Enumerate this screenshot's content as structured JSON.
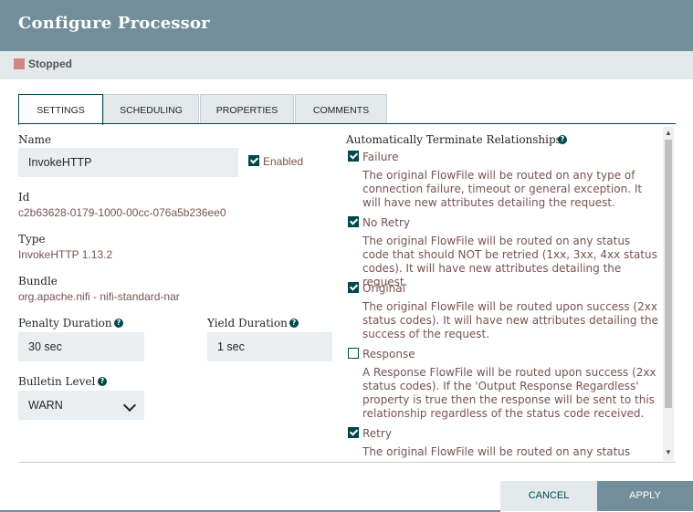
{
  "dialog": {
    "title": "Configure Processor"
  },
  "status": {
    "label": "Stopped",
    "color": "#d18686"
  },
  "tabs": [
    {
      "label": "Settings",
      "active": true
    },
    {
      "label": "Scheduling",
      "active": false
    },
    {
      "label": "Properties",
      "active": false
    },
    {
      "label": "Comments",
      "active": false
    }
  ],
  "settings": {
    "name_label": "Name",
    "name_value": "InvokeHTTP",
    "enabled_label": "Enabled",
    "enabled_checked": true,
    "id_label": "Id",
    "id_value": "c2b63628-0179-1000-00cc-076a5b236ee0",
    "type_label": "Type",
    "type_value": "InvokeHTTP 1.13.2",
    "bundle_label": "Bundle",
    "bundle_value": "org.apache.nifi - nifi-standard-nar",
    "penalty_label": "Penalty Duration",
    "penalty_value": "30 sec",
    "yield_label": "Yield Duration",
    "yield_value": "1 sec",
    "bulletin_label": "Bulletin Level",
    "bulletin_value": "WARN"
  },
  "relationships": {
    "heading": "Automatically Terminate Relationships",
    "items": [
      {
        "name": "Failure",
        "checked": true,
        "desc": "The original FlowFile will be routed on any type of connection failure, timeout or general exception. It will have new attributes detailing the request."
      },
      {
        "name": "No Retry",
        "checked": true,
        "desc": "The original FlowFile will be routed on any status code that should NOT be retried (1xx, 3xx, 4xx status codes). It will have new attributes detailing the request."
      },
      {
        "name": "Original",
        "checked": true,
        "desc": "The original FlowFile will be routed upon success (2xx status codes). It will have new attributes detailing the success of the request."
      },
      {
        "name": "Response",
        "checked": false,
        "desc": "A Response FlowFile will be routed upon success (2xx status codes). If the 'Output Response Regardless' property is true then the response will be sent to this relationship regardless of the status code received."
      },
      {
        "name": "Retry",
        "checked": true,
        "desc": "The original FlowFile will be routed on any status code"
      }
    ]
  },
  "buttons": {
    "cancel": "Cancel",
    "apply": "Apply"
  },
  "icons": {
    "help": "?"
  },
  "colors": {
    "header": "#728e9b",
    "accent": "#004849",
    "value_text": "#775351"
  }
}
